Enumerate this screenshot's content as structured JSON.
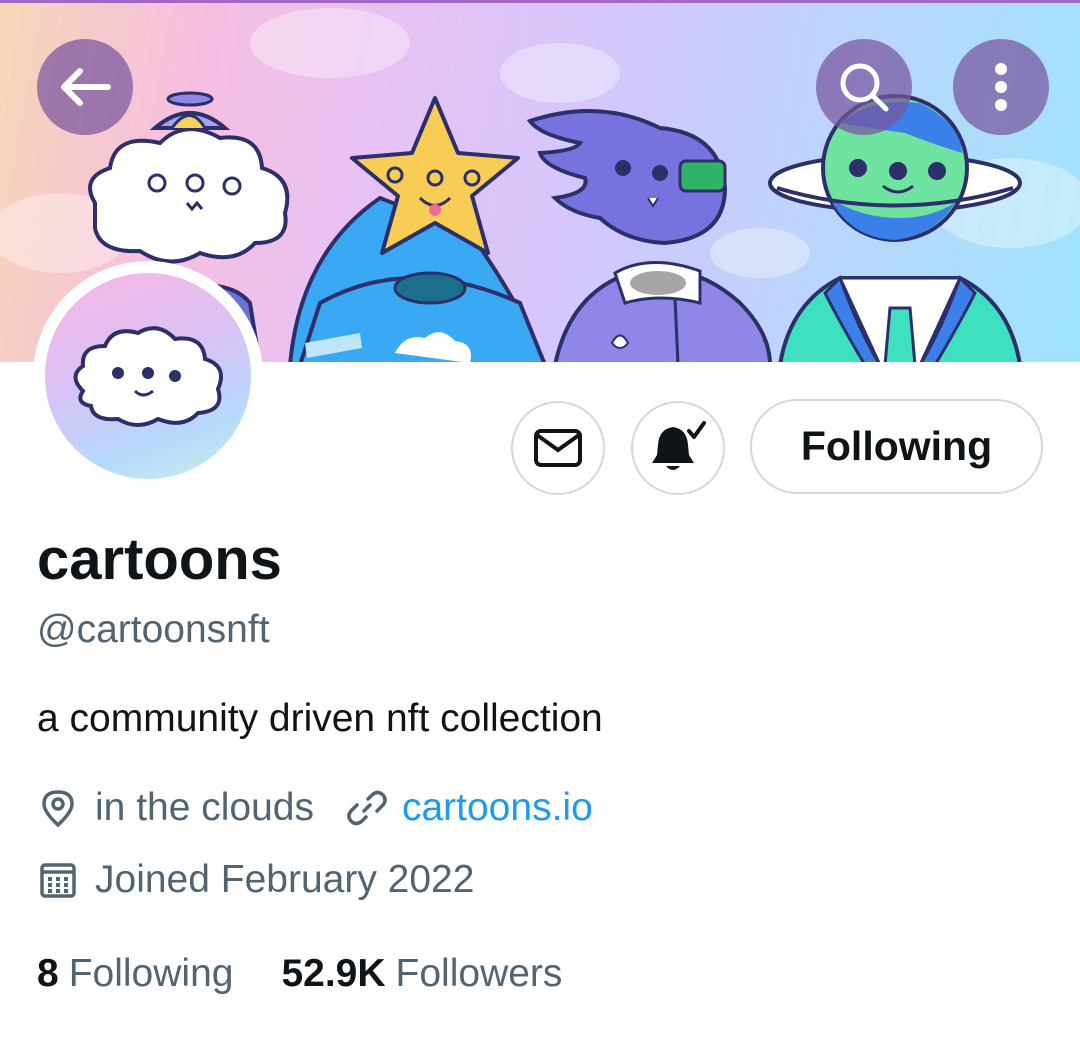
{
  "header": {
    "back_icon": "arrow-left-icon",
    "search_icon": "search-icon",
    "more_icon": "more-vertical-icon"
  },
  "profile": {
    "name": "cartoons",
    "handle": "@cartoonsnft",
    "bio": "a community driven nft collection",
    "location": "in the clouds",
    "website": "cartoons.io",
    "joined": "Joined February 2022"
  },
  "actions": {
    "message_icon": "envelope-icon",
    "notify_icon": "bell-check-icon",
    "following_label": "Following"
  },
  "stats": {
    "following_count": "8",
    "following_label": "Following",
    "followers_count": "52.9K",
    "followers_label": "Followers"
  },
  "colors": {
    "link": "#1d9bf0",
    "secondary_text": "#536471",
    "primary_text": "#0f1419"
  }
}
